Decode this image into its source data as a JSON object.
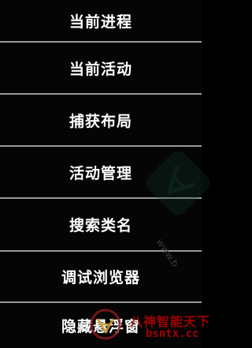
{
  "menu": {
    "items": [
      {
        "label": "当前进程"
      },
      {
        "label": "当前活动"
      },
      {
        "label": "捕获布局"
      },
      {
        "label": "活动管理"
      },
      {
        "label": "搜索类名"
      },
      {
        "label": "调试浏览器"
      },
      {
        "label": "隐藏悬浮窗"
      }
    ]
  },
  "watermark": {
    "brand_name": "八神智能天下",
    "brand_url": "bsntx.cc",
    "faint_url": "www.b",
    "accent_color": "#b30000"
  }
}
